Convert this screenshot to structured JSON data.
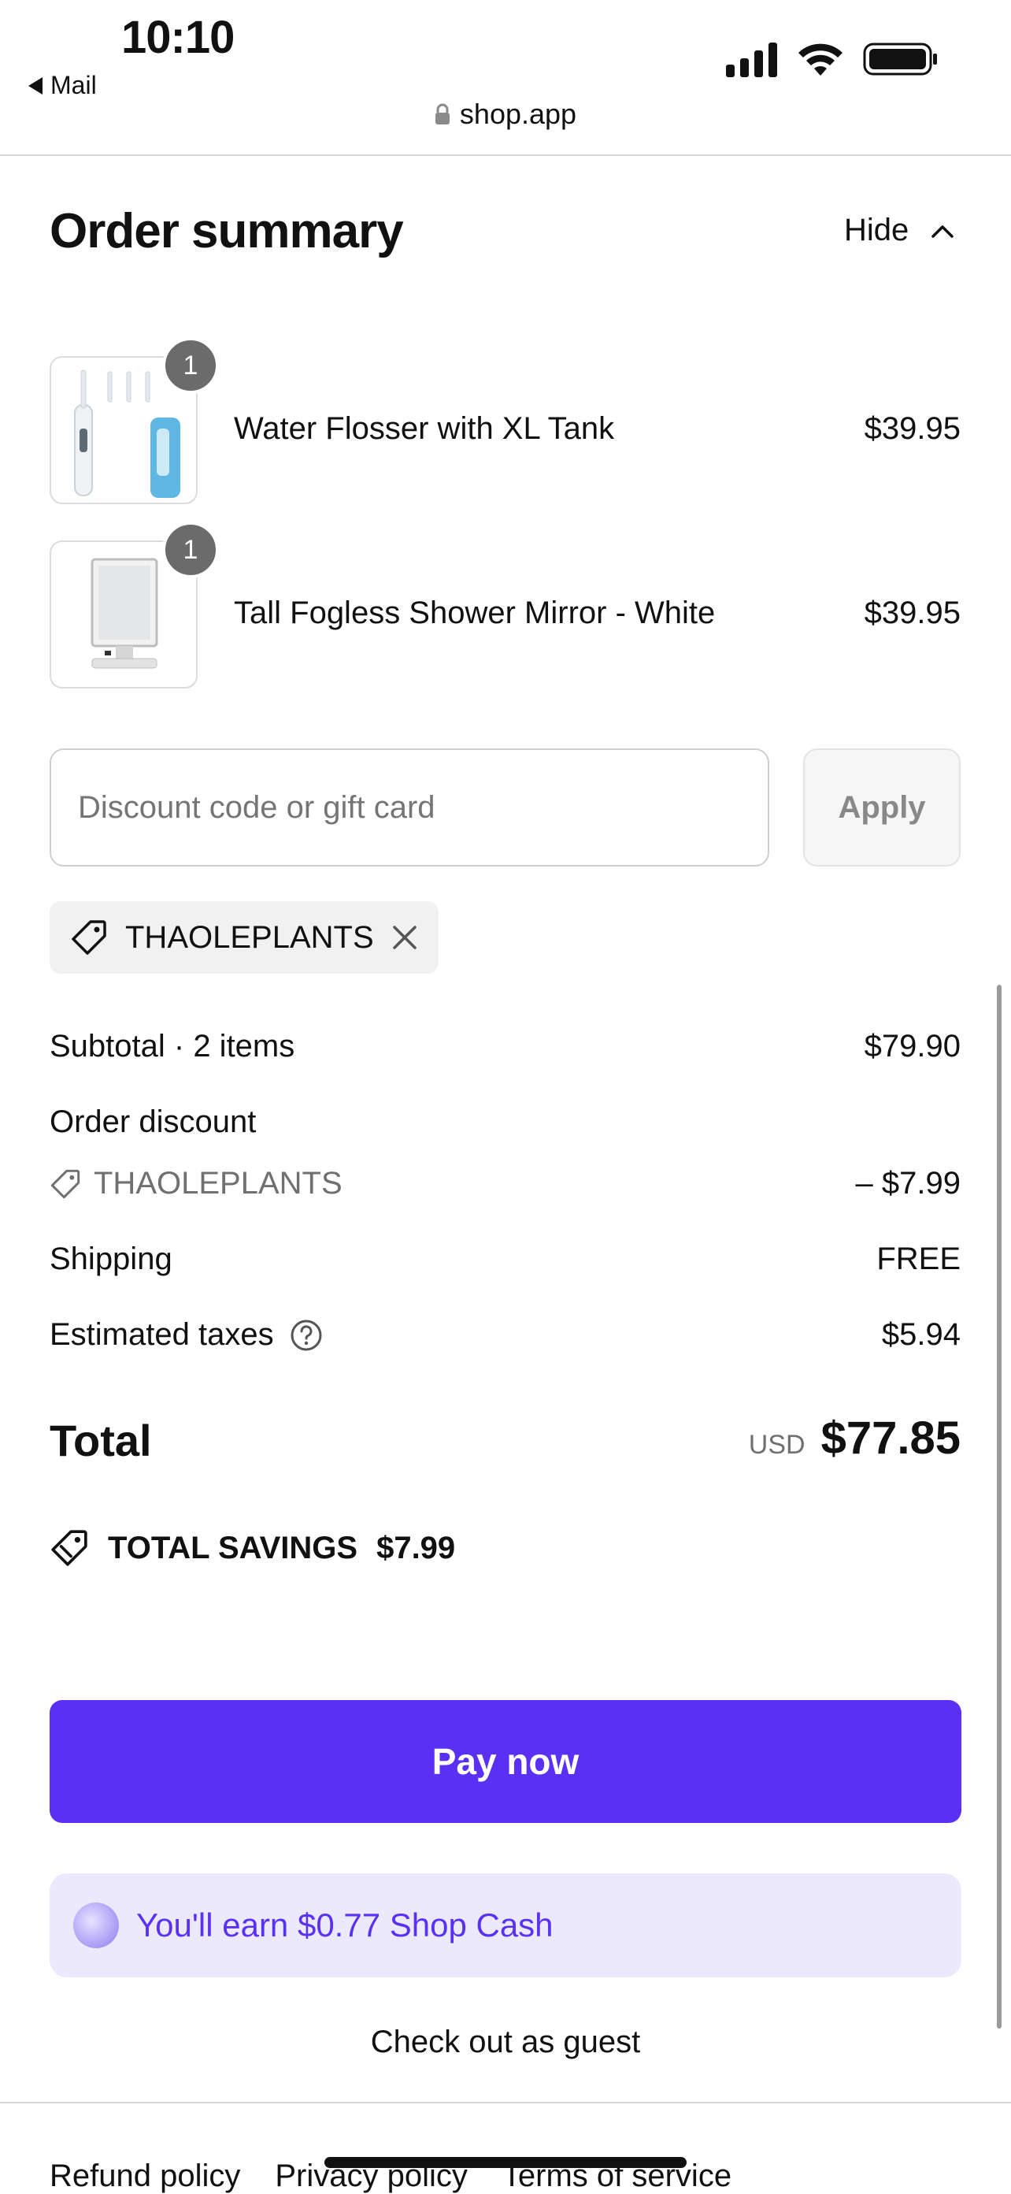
{
  "status_bar": {
    "time": "10:10",
    "back_label": "Mail"
  },
  "browser": {
    "url": "shop.app"
  },
  "summary": {
    "title": "Order summary",
    "toggle_label": "Hide"
  },
  "items": [
    {
      "name": "Water Flosser with XL Tank",
      "price": "$39.95",
      "qty": "1"
    },
    {
      "name": "Tall Fogless Shower Mirror - White",
      "price": "$39.95",
      "qty": "1"
    }
  ],
  "discount": {
    "placeholder": "Discount code or gift card",
    "apply_label": "Apply",
    "applied_code": "THAOLEPLANTS"
  },
  "totals": {
    "subtotal_label": "Subtotal · 2 items",
    "subtotal_value": "$79.90",
    "order_discount_label": "Order discount",
    "discount_code": "THAOLEPLANTS",
    "discount_value": "– $7.99",
    "shipping_label": "Shipping",
    "shipping_value": "FREE",
    "taxes_label": "Estimated taxes",
    "taxes_value": "$5.94",
    "total_label": "Total",
    "currency": "USD",
    "total_value": "$77.85",
    "savings_label": "TOTAL SAVINGS",
    "savings_value": "$7.99"
  },
  "actions": {
    "pay_label": "Pay now",
    "shop_cash_text": "You'll earn $0.77 Shop Cash",
    "guest_label": "Check out as guest"
  },
  "footer": {
    "links": [
      "Refund policy",
      "Privacy policy",
      "Terms of service"
    ]
  },
  "colors": {
    "accent": "#5a31f4",
    "shop_cash_bg": "#ece9fd"
  },
  "icons": [
    "signal-icon",
    "wifi-icon",
    "battery-icon",
    "lock-icon",
    "chevron-up-icon",
    "tag-icon",
    "close-icon",
    "help-icon",
    "savings-tag-icon",
    "shop-cash-coin-icon"
  ]
}
